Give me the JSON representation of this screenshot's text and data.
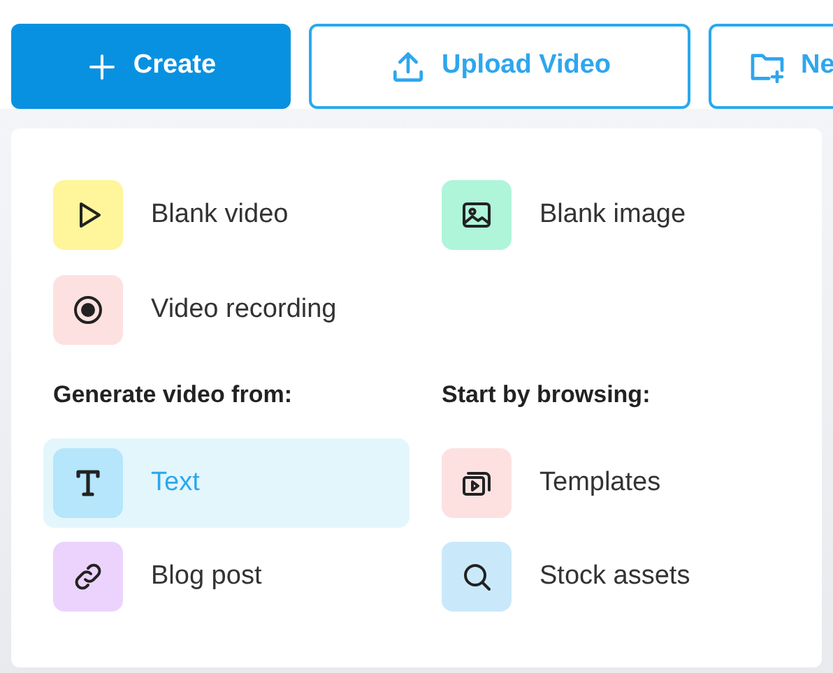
{
  "toolbar": [
    {
      "label": "Create",
      "kind": "primary"
    },
    {
      "label": "Upload Video",
      "kind": "outline"
    },
    {
      "label": "Ne",
      "kind": "outline"
    }
  ],
  "menu": {
    "quick_items": [
      {
        "label": "Blank video",
        "color": "#fff59a",
        "selected": false
      },
      {
        "label": "Blank image",
        "color": "#aef5da",
        "selected": false
      },
      {
        "label": "Video recording",
        "color": "#fde1e1",
        "selected": false
      }
    ],
    "sections": [
      {
        "heading": "Generate video from:",
        "items": [
          {
            "label": "Text",
            "color": "#b5e6fb",
            "selected": true
          },
          {
            "label": "Blog post",
            "color": "#ecd3fd",
            "selected": false
          }
        ]
      },
      {
        "heading": "Start by browsing:",
        "items": [
          {
            "label": "Templates",
            "color": "#fde1e1",
            "selected": false
          },
          {
            "label": "Stock assets",
            "color": "#c9e9fb",
            "selected": false
          }
        ]
      }
    ]
  }
}
